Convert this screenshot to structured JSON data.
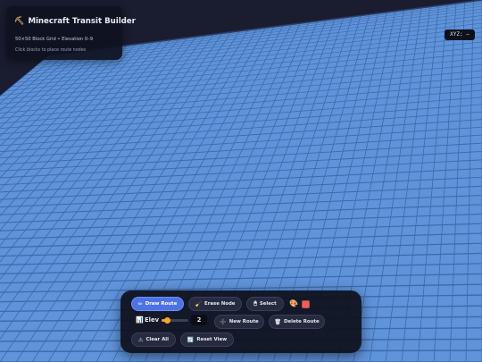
{
  "info": {
    "title": "Minecraft Transit Builder",
    "subtitle": "50×50 Block Grid • Elevation 0–9",
    "hint": "Click blocks to place route nodes",
    "title_icon": "pickaxe-icon"
  },
  "coords": {
    "label": "XYZ: —"
  },
  "toolbar": {
    "draw_route": "Draw Route",
    "erase_node": "Erase Node",
    "select": "Select",
    "elev_label": "Elev",
    "elev_value": "2",
    "elev_min": 0,
    "elev_max": 9,
    "new_route": "New Route",
    "delete_route": "Delete Route",
    "clear_all": "Clear All",
    "reset_view": "Reset View",
    "route_color": "#f25c5c",
    "icons": {
      "draw_route": "pencil-icon",
      "erase_node": "eraser-icon",
      "select": "mouse-icon",
      "palette": "palette-icon",
      "elev": "bar-chart-icon",
      "new_route": "plus-icon",
      "delete_route": "trash-icon",
      "clear_all": "warning-icon",
      "reset_view": "refresh-icon"
    }
  },
  "colors": {
    "block": "#5f93da",
    "block_dark": "#4a7ec8",
    "grid_line": "#3d6aa8",
    "background": "#1a1c30",
    "accent": "#4d72e6",
    "slider": "#f0a030"
  }
}
